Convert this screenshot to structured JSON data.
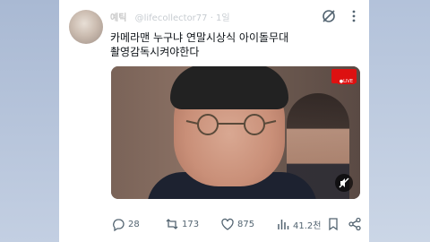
{
  "post": {
    "author_name": "예틱",
    "author_handle": "@lifecollector77 · 1일",
    "text_line1": "카메라맨 누구냐 연말시상식 아이돌무대",
    "text_line2": "촬영감독시켜야한다"
  },
  "media": {
    "live_badge": "●LIVE"
  },
  "actions": {
    "replies": "28",
    "reposts": "173",
    "likes": "875",
    "views": "41.2천"
  }
}
